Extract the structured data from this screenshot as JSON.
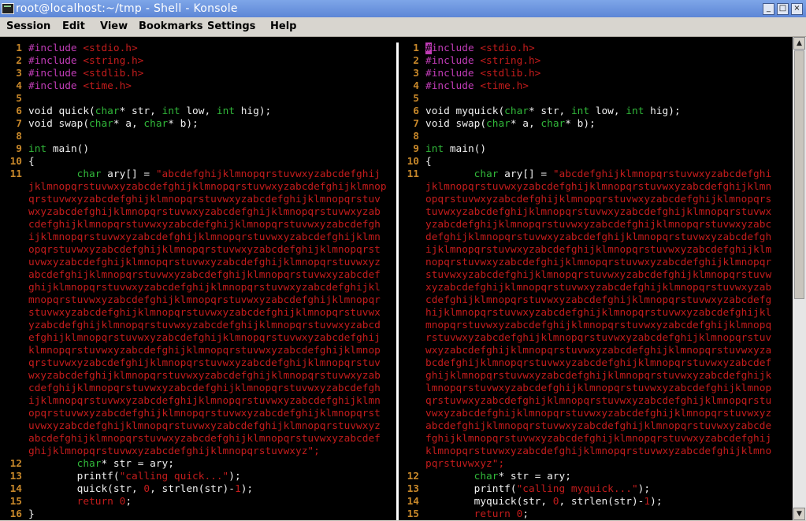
{
  "window": {
    "title": "root@localhost:~/tmp - Shell - Konsole",
    "min_label": "_",
    "max_label": "□",
    "close_label": "×"
  },
  "menu": [
    "Session",
    "Edit",
    "View",
    "Bookmarks",
    "Settings",
    "Help"
  ],
  "left_pane": {
    "lines": {
      "l1": {
        "n": "1",
        "pp": "#include",
        "inc": " <stdio.h>"
      },
      "l2": {
        "n": "2",
        "pp": "#include",
        "inc": " <string.h>"
      },
      "l3": {
        "n": "3",
        "pp": "#include",
        "inc": " <stdlib.h>"
      },
      "l4": {
        "n": "4",
        "pp": "#include",
        "inc": " <time.h>"
      },
      "l5": {
        "n": "5"
      },
      "l6": {
        "n": "6"
      },
      "l7": {
        "n": "7"
      },
      "l8": {
        "n": "8"
      },
      "l9": {
        "n": "9"
      },
      "l10": {
        "n": "10",
        "t": "{"
      },
      "l11": {
        "n": "11"
      },
      "l12": {
        "n": "12"
      },
      "l13": {
        "n": "13"
      },
      "l14": {
        "n": "14"
      },
      "l15": {
        "n": "15"
      },
      "l16": {
        "n": "16",
        "t": "}"
      }
    },
    "string_wrap": [
      "jklmnopqrstuvwxyzabcdefghijklmnopqrstuvwxyzabcdefghijklmnop",
      "qrstuvwxyzabcdefghijklmnopqrstuvwxyzabcdefghijklmnopqrstuv",
      "wxyzabcdefghijklmnopqrstuvwxyzabcdefghijklmnopqrstuvwxyzab",
      "cdefghijklmnopqrstuvwxyzabcdefghijklmnopqrstuvwxyzabcdefgh",
      "ijklmnopqrstuvwxyzabcdefghijklmnopqrstuvwxyzabcdefghijklmn",
      "opqrstuvwxyzabcdefghijklmnopqrstuvwxyzabcdefghijklmnopqrst",
      "uvwxyzabcdefghijklmnopqrstuvwxyzabcdefghijklmnopqrstuvwxyz",
      "abcdefghijklmnopqrstuvwxyzabcdefghijklmnopqrstuvwxyzabcdef",
      "ghijklmnopqrstuvwxyzabcdefghijklmnopqrstuvwxyzabcdefghijkl",
      "mnopqrstuvwxyzabcdefghijklmnopqrstuvwxyzabcdefghijklmnopqr",
      "stuvwxyzabcdefghijklmnopqrstuvwxyzabcdefghijklmnopqrstuvwx",
      "yzabcdefghijklmnopqrstuvwxyzabcdefghijklmnopqrstuvwxyzabcd",
      "efghijklmnopqrstuvwxyzabcdefghijklmnopqrstuvwxyzabcdefghij",
      "klmnopqrstuvwxyzabcdefghijklmnopqrstuvwxyzabcdefghijklmnop",
      "qrstuvwxyzabcdefghijklmnopqrstuvwxyzabcdefghijklmnopqrstuv",
      "wxyzabcdefghijklmnopqrstuvwxyzabcdefghijklmnopqrstuvwxyzab",
      "cdefghijklmnopqrstuvwxyzabcdefghijklmnopqrstuvwxyzabcdefgh",
      "ijklmnopqrstuvwxyzabcdefghijklmnopqrstuvwxyzabcdefghijklmn",
      "opqrstuvwxyzabcdefghijklmnopqrstuvwxyzabcdefghijklmnopqrst",
      "uvwxyzabcdefghijklmnopqrstuvwxyzabcdefghijklmnopqrstuvwxyz",
      "abcdefghijklmnopqrstuvwxyzabcdefghijklmnopqrstuvwxyzabcdef",
      "ghijklmnopqrstuvwxyzabcdefghijklmnopqrstuvwxyz\";"
    ],
    "code": {
      "quick_decl": [
        "void quick(",
        "char",
        "* str, ",
        "int",
        " low, ",
        "int",
        " hig);"
      ],
      "swap_decl": [
        "void swap(",
        "char",
        "* a, ",
        "char",
        "* b);"
      ],
      "main_decl": [
        "int",
        " main()"
      ],
      "ary": [
        "        ",
        "char",
        " ary[] = ",
        "\"abcdefghijklmnopqrstuvwxyzabcdefghij"
      ],
      "str_decl": [
        "        ",
        "char",
        "* str = ary;"
      ],
      "printf": [
        "        printf(",
        "\"calling quick...\"",
        ");"
      ],
      "quick_call": [
        "        quick(str, ",
        "0",
        ", strlen(str)-",
        "1",
        ");"
      ],
      "ret": [
        "        ",
        "return",
        " ",
        "0",
        ";"
      ]
    }
  },
  "right_pane": {
    "lines": {
      "l1": {
        "n": "1",
        "cursor": "#",
        "pp": "include",
        "inc": " <stdio.h>"
      },
      "l2": {
        "n": "2",
        "pp": "#include",
        "inc": " <string.h>"
      },
      "l3": {
        "n": "3",
        "pp": "#include",
        "inc": " <stdlib.h>"
      },
      "l4": {
        "n": "4",
        "pp": "#include",
        "inc": " <time.h>"
      },
      "l5": {
        "n": "5"
      },
      "l6": {
        "n": "6"
      },
      "l7": {
        "n": "7"
      },
      "l8": {
        "n": "8"
      },
      "l9": {
        "n": "9"
      },
      "l10": {
        "n": "10",
        "t": "{"
      },
      "l11": {
        "n": "11"
      },
      "l12": {
        "n": "12"
      },
      "l13": {
        "n": "13"
      },
      "l14": {
        "n": "14"
      },
      "l15": {
        "n": "15"
      }
    },
    "string_wrap": [
      "jklmnopqrstuvwxyzabcdefghijklmnopqrstuvwxyzabcdefghijklmn",
      "opqrstuvwxyzabcdefghijklmnopqrstuvwxyzabcdefghijklmnopqrs",
      "tuvwxyzabcdefghijklmnopqrstuvwxyzabcdefghijklmnopqrstuvwx",
      "yzabcdefghijklmnopqrstuvwxyzabcdefghijklmnopqrstuvwxyzabc",
      "defghijklmnopqrstuvwxyzabcdefghijklmnopqrstuvwxyzabcdefgh",
      "ijklmnopqrstuvwxyzabcdefghijklmnopqrstuvwxyzabcdefghijklm",
      "nopqrstuvwxyzabcdefghijklmnopqrstuvwxyzabcdefghijklmnopqr",
      "stuvwxyzabcdefghijklmnopqrstuvwxyzabcdefghijklmnopqrstuvw",
      "xyzabcdefghijklmnopqrstuvwxyzabcdefghijklmnopqrstuvwxyzab",
      "cdefghijklmnopqrstuvwxyzabcdefghijklmnopqrstuvwxyzabcdefg",
      "hijklmnopqrstuvwxyzabcdefghijklmnopqrstuvwxyzabcdefghijkl",
      "mnopqrstuvwxyzabcdefghijklmnopqrstuvwxyzabcdefghijklmnopq",
      "rstuvwxyzabcdefghijklmnopqrstuvwxyzabcdefghijklmnopqrstuv",
      "wxyzabcdefghijklmnopqrstuvwxyzabcdefghijklmnopqrstuvwxyza",
      "bcdefghijklmnopqrstuvwxyzabcdefghijklmnopqrstuvwxyzabcdef",
      "ghijklmnopqrstuvwxyzabcdefghijklmnopqrstuvwxyzabcdefghijk",
      "lmnopqrstuvwxyzabcdefghijklmnopqrstuvwxyzabcdefghijklmnop",
      "qrstuvwxyzabcdefghijklmnopqrstuvwxyzabcdefghijklmnopqrstu",
      "vwxyzabcdefghijklmnopqrstuvwxyzabcdefghijklmnopqrstuvwxyz",
      "abcdefghijklmnopqrstuvwxyzabcdefghijklmnopqrstuvwxyzabcde",
      "fghijklmnopqrstuvwxyzabcdefghijklmnopqrstuvwxyzabcdefghij",
      "klmnopqrstuvwxyzabcdefghijklmnopqrstuvwxyzabcdefghijklmno",
      "pqrstuvwxyz\";"
    ],
    "code": {
      "quick_decl": [
        "void myquick(",
        "char",
        "* str, ",
        "int",
        " low, ",
        "int",
        " hig);"
      ],
      "swap_decl": [
        "void swap(",
        "char",
        "* a, ",
        "char",
        "* b);"
      ],
      "main_decl": [
        "int",
        " main()"
      ],
      "ary": [
        "        ",
        "char",
        " ary[] = ",
        "\"abcdefghijklmnopqrstuvwxyzabcdefghi"
      ],
      "str_decl": [
        "        ",
        "char",
        "* str = ary;"
      ],
      "printf": [
        "        printf(",
        "\"calling myquick...\"",
        ");"
      ],
      "quick_call": [
        "        myquick(str, ",
        "0",
        ", strlen(str)-",
        "1",
        ");"
      ],
      "ret": [
        "        ",
        "return",
        " ",
        "0",
        ";"
      ]
    }
  },
  "colors": {
    "preprocessor": "#c03cb6",
    "type": "#31b83a",
    "string": "#c41c1c",
    "line_number": "#c8882a",
    "background": "#000000"
  }
}
